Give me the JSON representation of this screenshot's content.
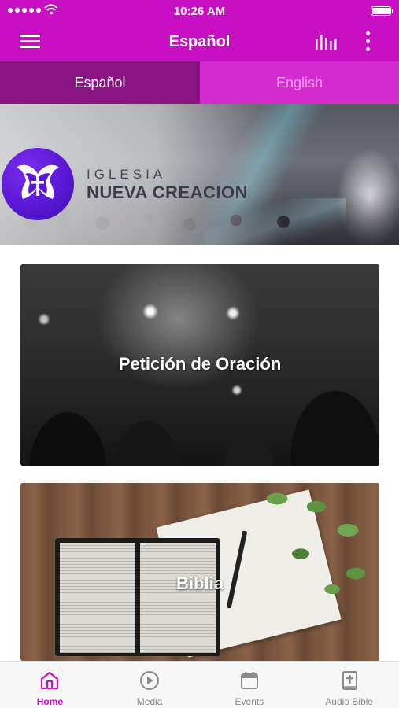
{
  "status_bar": {
    "time": "10:26 AM"
  },
  "app_bar": {
    "title": "Español"
  },
  "language_tabs": [
    {
      "label": "Español",
      "active": true
    },
    {
      "label": "English",
      "active": false
    }
  ],
  "banner": {
    "line1": "IGLESIA",
    "line2": "NUEVA CREACION"
  },
  "cards": [
    {
      "label": "Petición de Oración"
    },
    {
      "label": "Biblia"
    }
  ],
  "tab_bar": {
    "items": [
      {
        "label": "Home",
        "icon": "home-icon",
        "active": true
      },
      {
        "label": "Media",
        "icon": "play-circle-icon",
        "active": false
      },
      {
        "label": "Events",
        "icon": "calendar-icon",
        "active": false
      },
      {
        "label": "Audio Bible",
        "icon": "bible-icon",
        "active": false
      }
    ]
  },
  "colors": {
    "accent": "#c80fc3",
    "tab_active": "#8a1582",
    "tab_inactive": "#d42ad0"
  }
}
